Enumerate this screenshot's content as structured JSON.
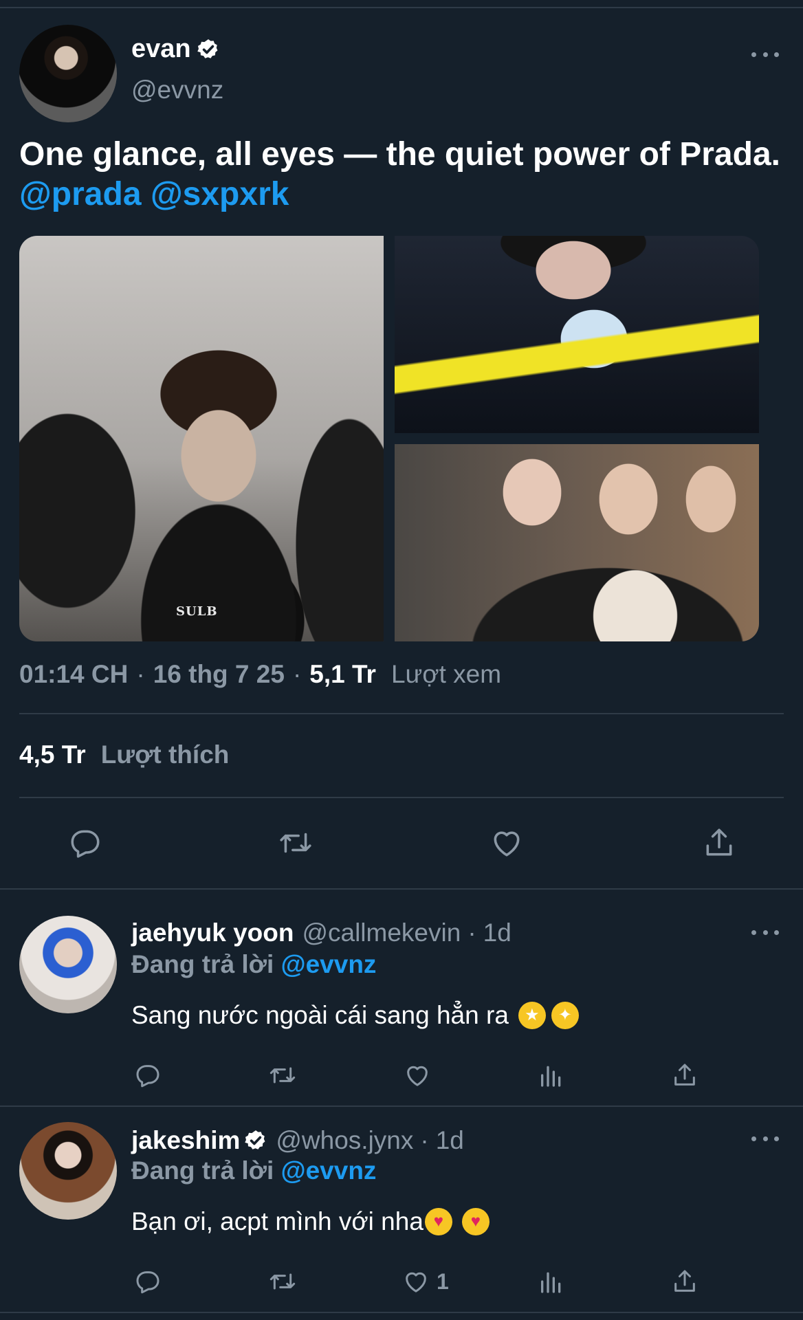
{
  "tweet": {
    "author_name": "evan",
    "author_handle": "@evvnz",
    "text": "One glance, all eyes — the quiet power of Prada.",
    "mention_1": "@prada",
    "mention_2": "@sxpxrk",
    "media_caption": "SULB",
    "time": "01:14 CH",
    "date": "16 thg 7 25",
    "views_count": "5,1 Tr",
    "views_label": "Lượt xem",
    "likes_count": "4,5 Tr",
    "likes_label": "Lượt thích"
  },
  "replies": [
    {
      "name": "jaehyuk yoon",
      "handle": "@callmekevin",
      "time": "1d",
      "replying_label": "Đang trả lời",
      "replying_to": "@evvnz",
      "text": "Sang nước ngoài cái sang hẳn ra",
      "emojis": [
        "star-struck",
        "partying-face"
      ],
      "like_count": ""
    },
    {
      "name": "jakeshim",
      "handle": "@whos.jynx",
      "time": "1d",
      "replying_label": "Đang trả lời",
      "replying_to": "@evvnz",
      "text": "Bạn ơi, acpt mình với nha",
      "emojis": [
        "smiling-face-with-hearts",
        "heart-eyes"
      ],
      "like_count": "1"
    }
  ],
  "colors": {
    "background": "#15202b",
    "accent": "#1d9bf0",
    "muted": "#8b98a5",
    "divider": "#2f3b47"
  }
}
